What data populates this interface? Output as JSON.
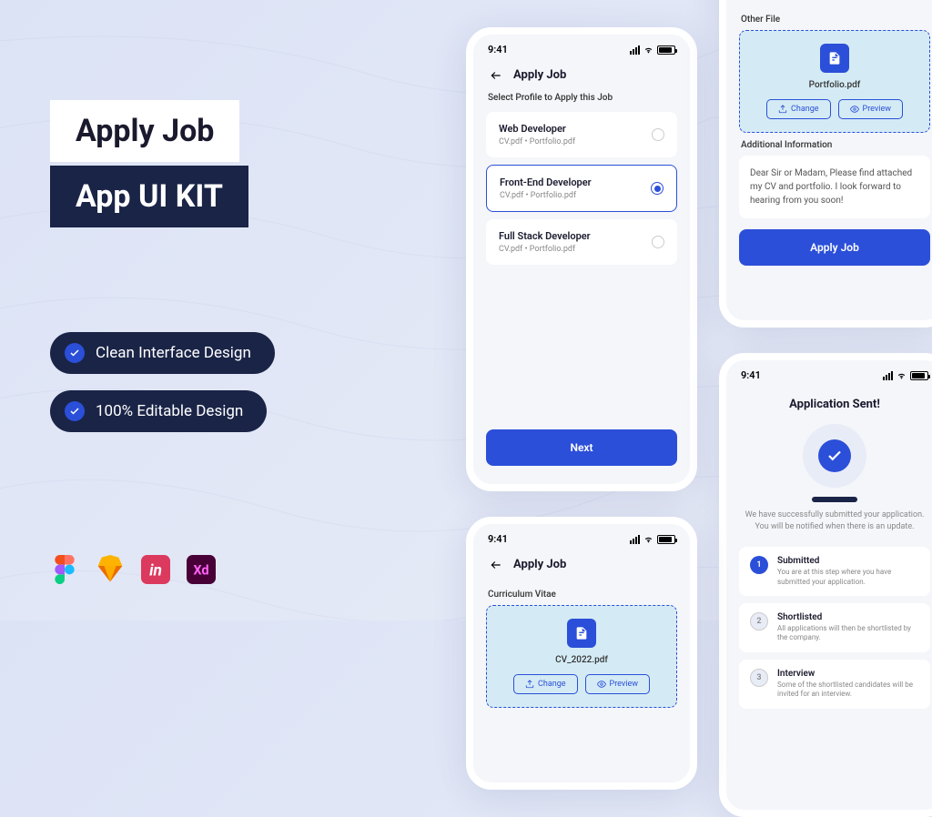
{
  "promo": {
    "title_line1": "Apply Job",
    "title_line2": "App UI KIT",
    "features": [
      "Clean Interface Design",
      "100% Editable Design"
    ],
    "tools": [
      "figma",
      "sketch",
      "invision",
      "xd"
    ]
  },
  "status": {
    "time": "9:41"
  },
  "screen1": {
    "title": "Apply Job",
    "subtitle": "Select Profile to Apply this Job",
    "profiles": [
      {
        "name": "Web Developer",
        "files": "CV.pdf  •  Portfolio.pdf",
        "selected": false
      },
      {
        "name": "Front-End Developer",
        "files": "CV.pdf  •  Portfolio.pdf",
        "selected": true
      },
      {
        "name": "Full Stack Developer",
        "files": "CV.pdf  •  Portfolio.pdf",
        "selected": false
      }
    ],
    "next_btn": "Next"
  },
  "screen2": {
    "other_file_label": "Other File",
    "portfolio_file": "Portfolio.pdf",
    "change_btn": "Change",
    "preview_btn": "Preview",
    "additional_label": "Additional Information",
    "message": "Dear Sir or Madam, Please find attached my CV and portfolio. I look forward to hearing from you soon!",
    "apply_btn": "Apply Job"
  },
  "screen3": {
    "title": "Application Sent!",
    "description": "We have successfully submitted your application. You will be notified when there is an update.",
    "steps": [
      {
        "num": "1",
        "title": "Submitted",
        "desc": "You are at this step where you have submitted your application.",
        "active": true
      },
      {
        "num": "2",
        "title": "Shortlisted",
        "desc": "All applications will then be shortlisted by the company.",
        "active": false
      },
      {
        "num": "3",
        "title": "Interview",
        "desc": "Some of the shortlisted candidates will be invited for an interview.",
        "active": false
      }
    ]
  },
  "screen4": {
    "title": "Apply Job",
    "cv_label": "Curriculum Vitae",
    "cv_file": "CV_2022.pdf",
    "change_btn": "Change",
    "preview_btn": "Preview"
  }
}
